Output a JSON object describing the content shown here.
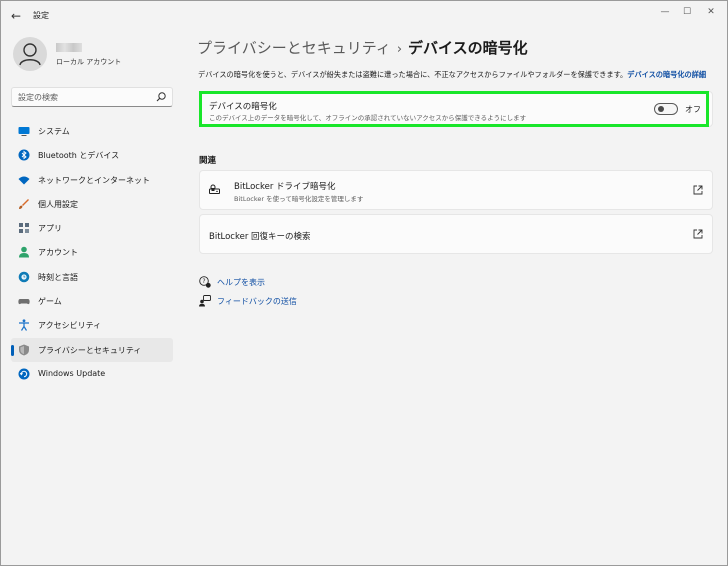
{
  "app": {
    "title": "設定",
    "back_icon": "arrow-left-icon",
    "window_controls": [
      "minimize-icon",
      "maximize-icon",
      "close-icon"
    ]
  },
  "profile": {
    "account_type": "ローカル アカウント"
  },
  "search": {
    "placeholder": "設定の検索"
  },
  "sidebar": {
    "items": [
      {
        "label": "システム",
        "icon": "monitor-icon",
        "color": "#0078d4"
      },
      {
        "label": "Bluetooth とデバイス",
        "icon": "bluetooth-icon",
        "color": "#0067c0"
      },
      {
        "label": "ネットワークとインターネット",
        "icon": "wifi-icon",
        "color": "#0067c0"
      },
      {
        "label": "個人用設定",
        "icon": "brush-icon",
        "color": "#d86b2a"
      },
      {
        "label": "アプリ",
        "icon": "apps-icon",
        "color": "#5a6b7c"
      },
      {
        "label": "アカウント",
        "icon": "person-icon",
        "color": "#2ea36b"
      },
      {
        "label": "時刻と言語",
        "icon": "globe-clock-icon",
        "color": "#0f7bb6"
      },
      {
        "label": "ゲーム",
        "icon": "gamepad-icon",
        "color": "#6f6f6f"
      },
      {
        "label": "アクセシビリティ",
        "icon": "accessibility-icon",
        "color": "#1a72c9"
      },
      {
        "label": "プライバシーとセキュリティ",
        "icon": "shield-icon",
        "color": "#7a7a7a",
        "active": true
      },
      {
        "label": "Windows Update",
        "icon": "update-icon",
        "color": "#0067c0"
      }
    ]
  },
  "main": {
    "breadcrumb_parent": "プライバシーとセキュリティ",
    "breadcrumb_sep": "›",
    "breadcrumb_current": "デバイスの暗号化",
    "description": "デバイスの暗号化を使うと、デバイスが紛失または盗難に遭った場合に、不正なアクセスからファイルやフォルダーを保護できます。",
    "description_link": "デバイスの暗号化の詳細",
    "encryption_card": {
      "title": "デバイスの暗号化",
      "subtitle": "このデバイス上のデータを暗号化して、オフラインの承認されていないアクセスから保護できるようにします",
      "toggle_label": "オフ",
      "toggle_on": false
    },
    "related_title": "関連",
    "related": [
      {
        "title": "BitLocker ドライブ暗号化",
        "subtitle": "BitLocker を使って暗号化設定を管理します",
        "icon": "drive-lock-icon"
      },
      {
        "title": "BitLocker 回復キーの検索"
      }
    ],
    "help_links": [
      {
        "label": "ヘルプを表示",
        "icon": "help-icon"
      },
      {
        "label": "フィードバックの送信",
        "icon": "feedback-icon"
      }
    ]
  },
  "colors": {
    "accent": "#005fb8",
    "link": "#0f4ea3",
    "highlight": "#19e62a"
  }
}
